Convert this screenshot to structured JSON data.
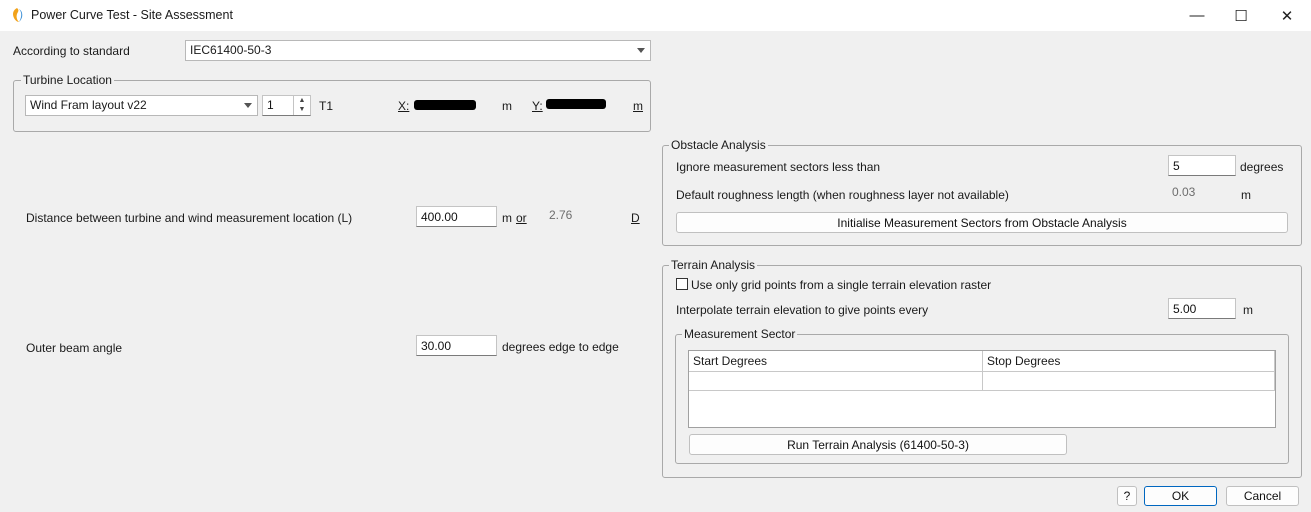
{
  "window": {
    "title": "Power Curve Test - Site Assessment",
    "controls": {
      "minimize": "—",
      "maximize": "☐",
      "close": "✕"
    }
  },
  "standard": {
    "label": "According to standard",
    "value": "IEC61400-50-3"
  },
  "turbine_location": {
    "title": "Turbine Location",
    "layout": "Wind Fram layout v22",
    "index": "1",
    "turbine_id": "T1",
    "x_label": "X:",
    "x_unit": "m",
    "y_label": "Y:",
    "y_unit": "m"
  },
  "distance": {
    "label": "Distance between turbine and wind measurement location (L)",
    "value": "400.00",
    "unit_m": "m",
    "or": "or",
    "d_value": "2.76",
    "d_unit": "D"
  },
  "beam": {
    "label": "Outer beam angle",
    "value": "30.00",
    "unit": "degrees edge to edge"
  },
  "obstacle": {
    "title": "Obstacle Analysis",
    "ignore_label": "Ignore measurement sectors less than",
    "ignore_value": "5",
    "ignore_unit": "degrees",
    "roughness_label": "Default roughness length (when roughness layer not available)",
    "roughness_value": "0.03",
    "roughness_unit": "m",
    "init_button": "Initialise Measurement Sectors from Obstacle Analysis"
  },
  "terrain": {
    "title": "Terrain Analysis",
    "single_raster_label": "Use only grid points from a single terrain elevation raster",
    "single_raster_checked": false,
    "interpolate_label": "Interpolate terrain elevation to give points every",
    "interpolate_value": "5.00",
    "interpolate_unit": "m",
    "sector": {
      "title": "Measurement Sector",
      "columns": [
        "Start Degrees",
        "Stop Degrees"
      ]
    },
    "run_button": "Run Terrain Analysis (61400-50-3)"
  },
  "footer": {
    "help": "?",
    "ok": "OK",
    "cancel": "Cancel"
  },
  "colors": {
    "accent": "#0067c0",
    "background": "#f0f0f0"
  }
}
